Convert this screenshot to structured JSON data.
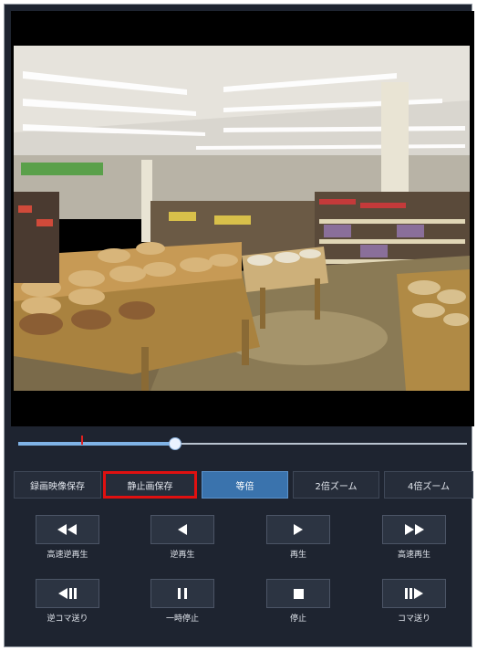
{
  "video": {
    "scene": "supermarket-interior",
    "signboard_color": "#5aa04a"
  },
  "timeline": {
    "progress": 0.35,
    "marker_position": 0.14
  },
  "tabs": [
    {
      "label": "録画映像保存",
      "state": "normal"
    },
    {
      "label": "静止画保存",
      "state": "highlighted"
    },
    {
      "label": "等倍",
      "state": "active"
    },
    {
      "label": "2倍ズーム",
      "state": "normal"
    },
    {
      "label": "4倍ズーム",
      "state": "normal"
    }
  ],
  "controls": {
    "row1": [
      {
        "icon": "fast-rewind-icon",
        "label": "高速逆再生"
      },
      {
        "icon": "reverse-play-icon",
        "label": "逆再生"
      },
      {
        "icon": "play-icon",
        "label": "再生"
      },
      {
        "icon": "fast-forward-icon",
        "label": "高速再生"
      }
    ],
    "row2": [
      {
        "icon": "step-back-icon",
        "label": "逆コマ送り"
      },
      {
        "icon": "pause-icon",
        "label": "一時停止"
      },
      {
        "icon": "stop-icon",
        "label": "停止"
      },
      {
        "icon": "step-forward-icon",
        "label": "コマ送り"
      }
    ]
  },
  "colors": {
    "panel_bg": "#1e2430",
    "active_tab": "#3a73ad",
    "highlight_border": "#e01010",
    "seek_marker": "#e02020"
  }
}
